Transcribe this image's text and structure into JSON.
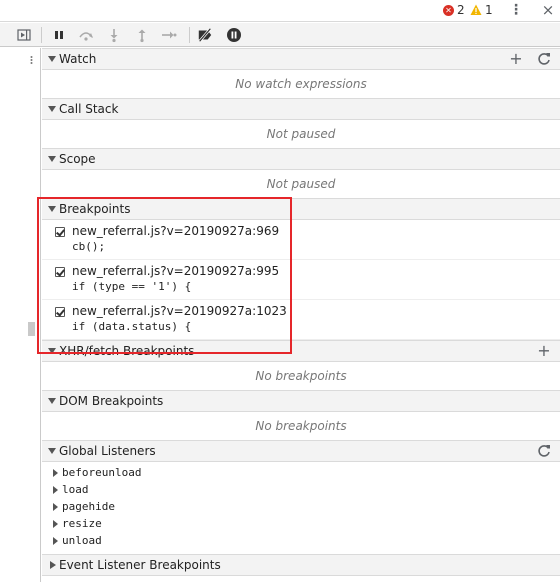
{
  "status": {
    "errors": "2",
    "warnings": "1"
  },
  "sections": {
    "watch": {
      "title": "Watch",
      "empty": "No watch expressions"
    },
    "call_stack": {
      "title": "Call Stack",
      "empty": "Not paused"
    },
    "scope": {
      "title": "Scope",
      "empty": "Not paused"
    },
    "breakpoints": {
      "title": "Breakpoints",
      "items": [
        {
          "location": "new_referral.js?v=20190927a:969",
          "code": "cb();"
        },
        {
          "location": "new_referral.js?v=20190927a:995",
          "code": "if (type == '1') {"
        },
        {
          "location": "new_referral.js?v=20190927a:1023",
          "code": "if (data.status) {"
        }
      ]
    },
    "xhr": {
      "title": "XHR/fetch Breakpoints",
      "empty": "No breakpoints"
    },
    "dom": {
      "title": "DOM Breakpoints",
      "empty": "No breakpoints"
    },
    "global_listeners": {
      "title": "Global Listeners",
      "items": [
        "beforeunload",
        "load",
        "pagehide",
        "resize",
        "unload"
      ]
    },
    "event_listener": {
      "title": "Event Listener Breakpoints"
    }
  },
  "colors": {
    "error": "#d93025",
    "warning": "#f2b600",
    "highlight_box": "#e5262a"
  }
}
